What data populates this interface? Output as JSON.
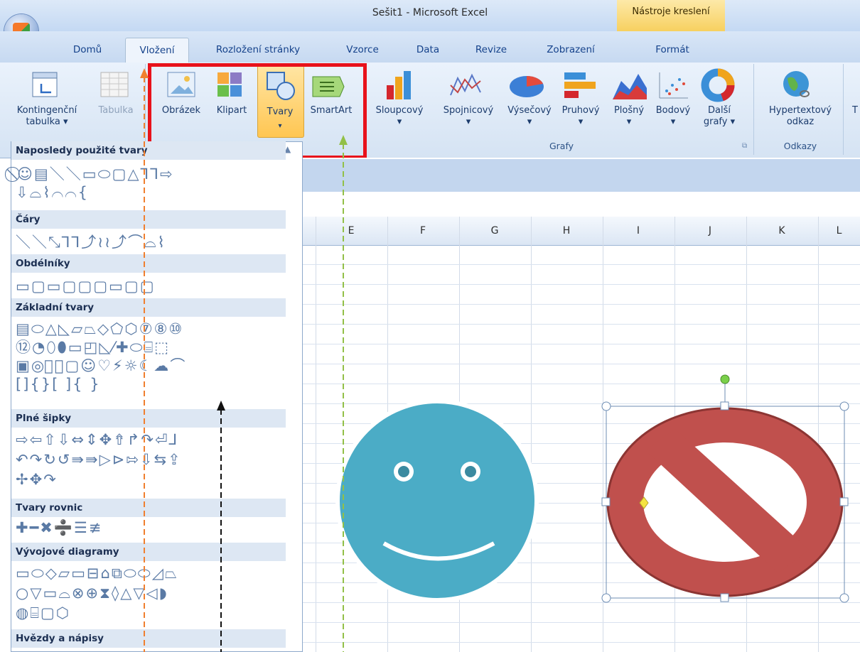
{
  "window": {
    "title": "Sešit1 - Microsoft Excel",
    "context_tab_title": "Nástroje kreslení"
  },
  "tabs": [
    "Domů",
    "Vložení",
    "Rozložení stránky",
    "Vzorce",
    "Data",
    "Revize",
    "Zobrazení",
    "Formát"
  ],
  "active_tab": "Vložení",
  "ribbon": {
    "tables": {
      "pivot_label_1": "Kontingenční",
      "pivot_label_2": "tabulka",
      "table_label": "Tabulka"
    },
    "illustrations": {
      "picture": "Obrázek",
      "clipart": "Klipart",
      "shapes": "Tvary",
      "smartart": "SmartArt"
    },
    "charts": {
      "group_label": "Grafy",
      "items": [
        "Sloupcový",
        "Spojnicový",
        "Výsečový",
        "Pruhový",
        "Plošný",
        "Bodový"
      ],
      "more_1": "Další",
      "more_2": "grafy"
    },
    "links": {
      "group_label": "Odkazy",
      "hyperlink_1": "Hypertextový",
      "hyperlink_2": "odkaz",
      "cut": "T"
    }
  },
  "sheet": {
    "columns": [
      "E",
      "F",
      "G",
      "H",
      "I",
      "J",
      "K",
      "L"
    ]
  },
  "gallery": {
    "sections": {
      "recent": "Naposledy použité tvary",
      "lines": "Čáry",
      "rects": "Obdélníky",
      "basic": "Základní tvary",
      "arrows": "Plné šipky",
      "equations": "Tvary rovnic",
      "flowchart": "Vývojové diagramy",
      "stars": "Hvězdy a nápisy"
    },
    "rows": {
      "recent_1": "⃠☺▤＼＼▭⬭▢△⅂⅂⇨",
      "recent_2": "⇩⌓⌇⌒⌒{",
      "lines_1": "＼＼⤡⅂⅂⤴≀≀⤴⌒⌓⌇",
      "rects_1": "▭▢▭▢▢▢▭▢▢",
      "basic_1": "▤⬭△◺▱⏢◇⬠⬡⑦⑧⑩",
      "basic_2": "⑫◔⬯⬮▭◰◺⁄✚⬭⌸⬚",
      "basic_3": "▣◎⃠⌒▢☺♡⚡☼☾☁⌒",
      "basic_4": "[]{}[ ]{ }",
      "arrows_1": "⇨⇦⇧⇩⇔⇕✥⇮↱↷⏎⅃",
      "arrows_2": "↶↷↻↺⇛⇛▷⊳⇰⇩⇆⇪",
      "arrows_3": "✢✥↷",
      "equations_1": "✚━✖➗☰≢",
      "flow_1": "▭⬭◇▱▭⊟⌂⧉⬭⬭◿⏢",
      "flow_2": "○▽▭⌓⊗⊕⧗◊△▽◁◗",
      "flow_3": "◍⌸▢⬡"
    }
  }
}
